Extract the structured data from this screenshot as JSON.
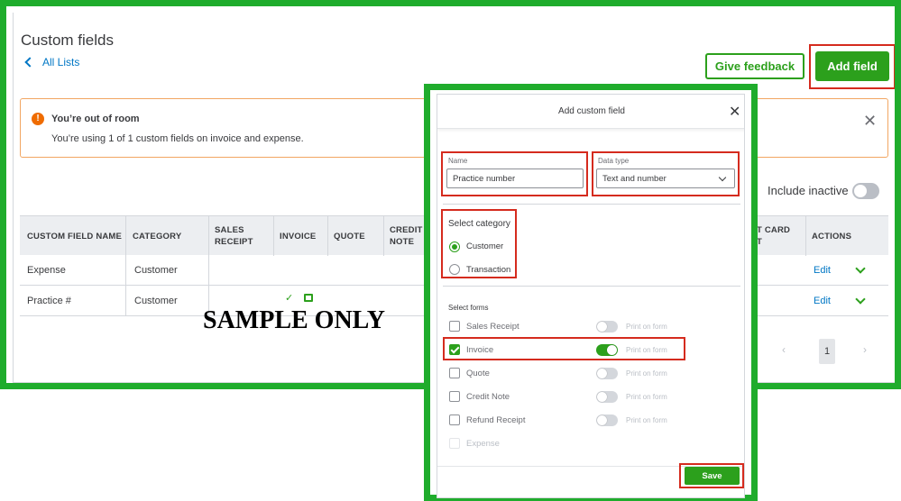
{
  "page": {
    "title": "Custom fields",
    "all_lists": "All Lists",
    "give_feedback": "Give feedback",
    "add_field": "Add field"
  },
  "alert": {
    "icon": "!",
    "title": "You’re out of room",
    "body": "You’re using 1 of 1 custom fields on invoice and expense."
  },
  "filter": {
    "include_inactive": "Include inactive"
  },
  "table": {
    "headers": {
      "name": "CUSTOM FIELD NAME",
      "category": "CATEGORY",
      "sales_receipt_1": "SALES",
      "sales_receipt_2": "RECEIPT",
      "invoice": "INVOICE",
      "quote": "QUOTE",
      "credit_note_1": "CREDIT",
      "credit_note_2": "NOTE",
      "credit_card_1": "T CARD",
      "credit_card_2": "T",
      "actions": "ACTIONS"
    },
    "rows": [
      {
        "name": "Expense",
        "category": "Customer",
        "action": "Edit"
      },
      {
        "name": "Practice #",
        "category": "Customer",
        "invoice_check": "✓",
        "action": "Edit"
      }
    ]
  },
  "watermark": "SAMPLE ONLY",
  "pager": {
    "prev": "‹",
    "page": "1",
    "next": "›"
  },
  "modal": {
    "title": "Add custom field",
    "close": "✕",
    "name_label": "Name",
    "name_value": "Practice number",
    "datatype_label": "Data type",
    "datatype_value": "Text and number",
    "category_title": "Select category",
    "categories": [
      "Customer",
      "Transaction"
    ],
    "selected_category": "Customer",
    "forms_title": "Select forms",
    "forms": [
      {
        "label": "Sales Receipt",
        "checked": false,
        "print_on_form": false,
        "print_label": "Print on form"
      },
      {
        "label": "Invoice",
        "checked": true,
        "print_on_form": true,
        "print_label": "Print on form"
      },
      {
        "label": "Quote",
        "checked": false,
        "print_on_form": false,
        "print_label": "Print on form"
      },
      {
        "label": "Credit Note",
        "checked": false,
        "print_on_form": false,
        "print_label": "Print on form"
      },
      {
        "label": "Refund Receipt",
        "checked": false,
        "print_on_form": false,
        "print_label": "Print on form"
      },
      {
        "label": "Expense",
        "checked": false,
        "disabled": true
      }
    ],
    "save": "Save"
  },
  "colors": {
    "brand_green": "#2ca01c",
    "frame_green": "#1fac2c",
    "highlight_red": "#d52b1e",
    "link_blue": "#0077c5",
    "alert_orange": "#ef6c00"
  }
}
